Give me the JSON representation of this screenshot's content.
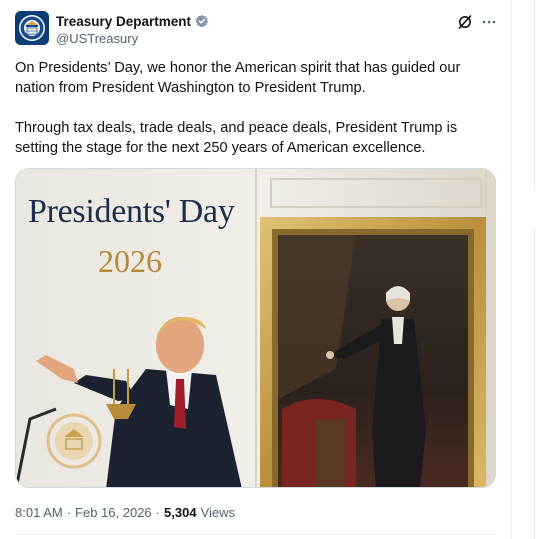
{
  "account": {
    "display_name": "Treasury Department",
    "handle": "@USTreasury",
    "verified": true,
    "verified_color": "#829aab"
  },
  "tweet": {
    "paragraphs": [
      "On Presidents’ Day, we honor the American spirit that has guided our nation from President Washington to President Trump.",
      "Through tax deals, trade deals, and peace deals, President Trump is setting the stage for the next 250 years of American excellence."
    ],
    "media": {
      "title": "Presidents' Day",
      "year": "2026"
    },
    "time": "8:01 AM",
    "date": "Feb 16, 2026",
    "views_count": "5,304",
    "views_label": "Views"
  },
  "icons": {
    "avatar": "treasury-seal-icon",
    "verified": "verified-badge-icon",
    "grok": "grok-icon",
    "more": "more-icon"
  }
}
